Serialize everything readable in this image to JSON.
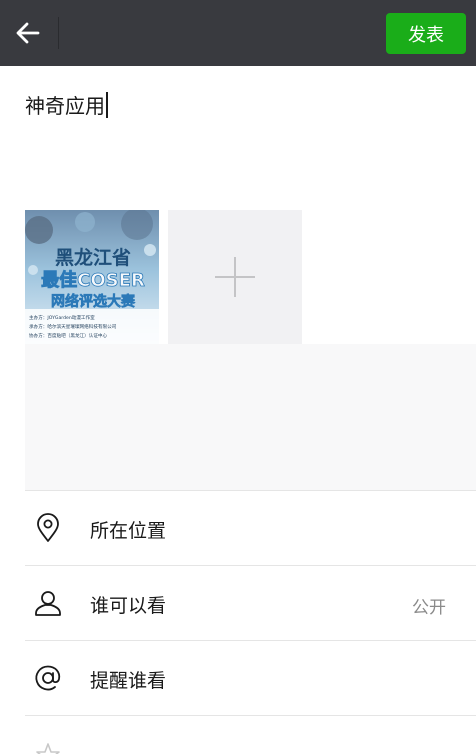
{
  "header": {
    "back_icon": "arrow-left-icon",
    "post_label": "发表",
    "accent": "#1aad19",
    "bar_color": "#393a3f"
  },
  "compose": {
    "text": "神奇应用",
    "attached_image": {
      "line1": "黑龙江省",
      "line2": "最佳COSER",
      "line3": "网络评选大赛",
      "info": [
        "主办方：JOYGarden动漫工作室",
        "承办方：哈尔滨天星璀璨网络科技有限公司",
        "协办方：百度贴吧（黑龙江）认证中心"
      ]
    },
    "add_photo_icon": "plus-icon"
  },
  "options": [
    {
      "icon": "location-pin-icon",
      "label": "所在位置",
      "value": ""
    },
    {
      "icon": "person-icon",
      "label": "谁可以看",
      "value": "公开"
    },
    {
      "icon": "at-sign-icon",
      "label": "提醒谁看",
      "value": ""
    }
  ]
}
